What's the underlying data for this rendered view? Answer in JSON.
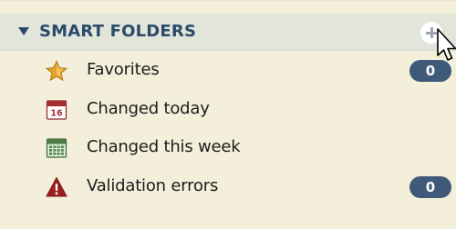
{
  "header": {
    "title": "SMART FOLDERS",
    "collapse_icon": "triangle-down-icon",
    "add_icon": "plus-icon"
  },
  "items": [
    {
      "label": "Favorites",
      "icon": "star-icon",
      "badge": "0"
    },
    {
      "label": "Changed today",
      "icon": "calendar-day-icon",
      "calendar_day": "16"
    },
    {
      "label": "Changed this week",
      "icon": "calendar-week-icon"
    },
    {
      "label": "Validation errors",
      "icon": "warning-icon",
      "badge": "0"
    }
  ],
  "colors": {
    "header_text": "#2b4a6b",
    "badge_bg": "#3f5a78",
    "panel_bg": "#f3efdb",
    "header_bg": "#e2e6da"
  }
}
